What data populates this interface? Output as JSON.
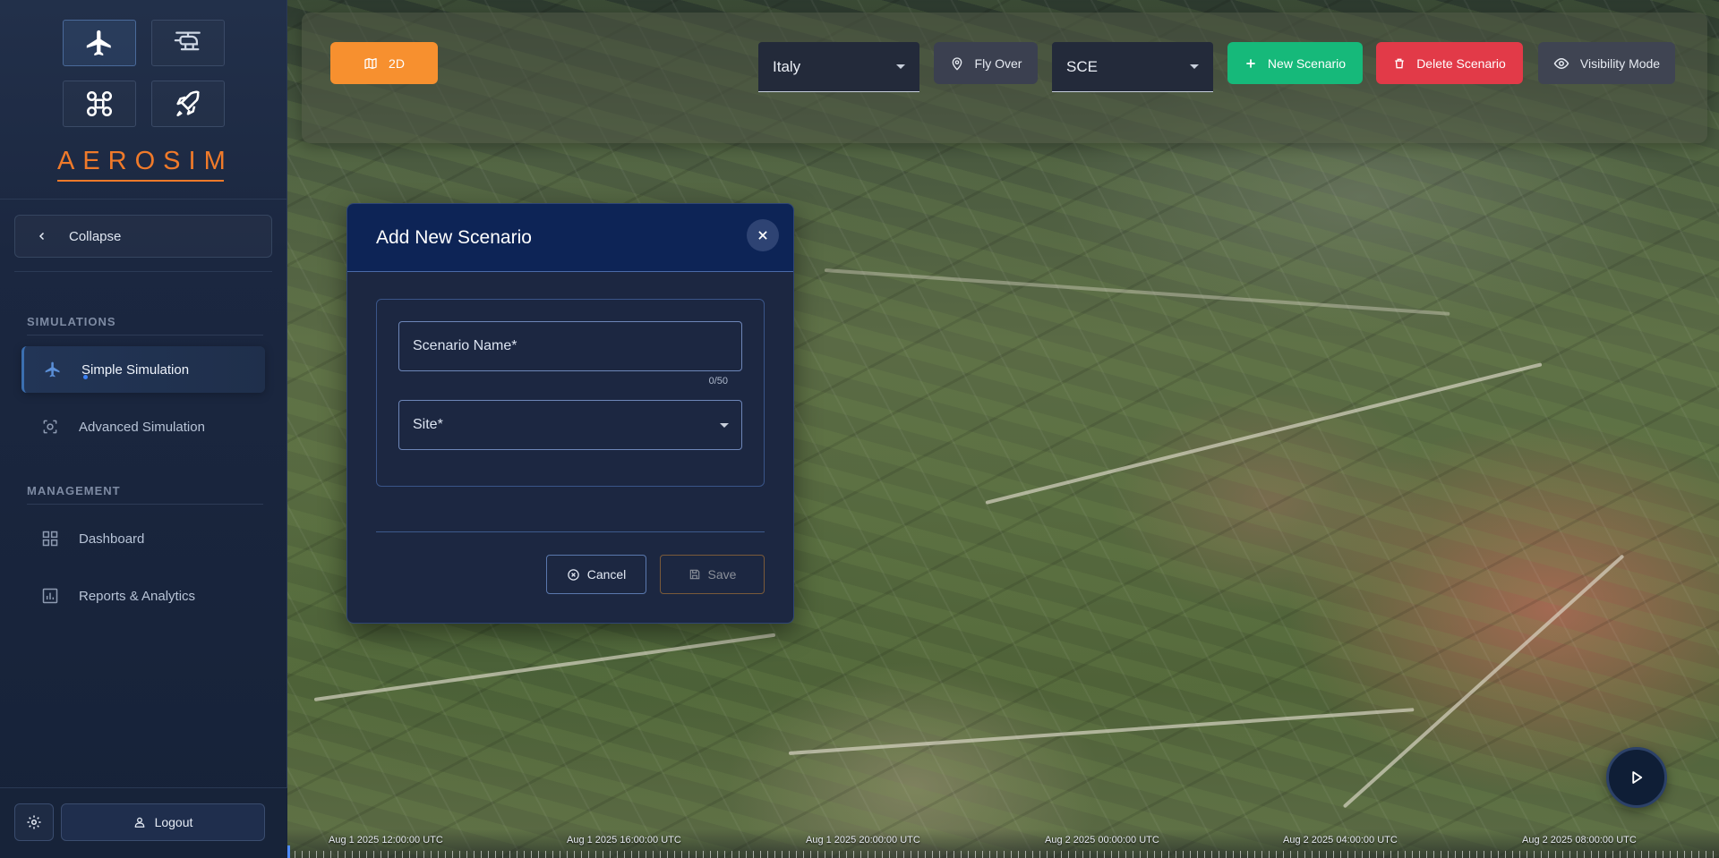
{
  "app": {
    "logo": "AEROSIM"
  },
  "sidebar": {
    "vehicles": [
      {
        "name": "airplane-icon",
        "active": true
      },
      {
        "name": "helicopter-icon",
        "active": false
      },
      {
        "name": "drone-icon",
        "active": false
      },
      {
        "name": "rocket-icon",
        "active": false
      }
    ],
    "collapse_label": "Collapse",
    "sections": {
      "simulations": "SIMULATIONS",
      "management": "MANAGEMENT"
    },
    "items": [
      {
        "label": "Simple Simulation",
        "icon": "airplane-icon",
        "active": true
      },
      {
        "label": "Advanced Simulation",
        "icon": "scan-icon",
        "active": false
      },
      {
        "label": "Dashboard",
        "icon": "dashboard-icon",
        "active": false
      },
      {
        "label": "Reports & Analytics",
        "icon": "chart-icon",
        "active": false
      }
    ],
    "logout_label": "Logout"
  },
  "toolbar": {
    "view_mode_label": "2D",
    "country_select": "Italy",
    "flyover_label": "Fly Over",
    "site_select": "SCE",
    "new_scenario_label": "New Scenario",
    "delete_scenario_label": "Delete Scenario",
    "visibility_label": "Visibility Mode"
  },
  "dialog": {
    "title": "Add New Scenario",
    "name_field_label": "Scenario Name*",
    "name_counter": "0/50",
    "site_field_label": "Site*",
    "cancel_label": "Cancel",
    "save_label": "Save"
  },
  "timeline": {
    "labels": [
      "Aug 1 2025 12:00:00 UTC",
      "Aug 1 2025 16:00:00 UTC",
      "Aug 1 2025 20:00:00 UTC",
      "Aug 2 2025 00:00:00 UTC",
      "Aug 2 2025 04:00:00 UTC",
      "Aug 2 2025 08:00:00 UTC"
    ]
  },
  "colors": {
    "accent_orange": "#f7902f",
    "new_green": "#16b97a",
    "delete_red": "#e23a48",
    "dialog_header": "#0d2456"
  }
}
